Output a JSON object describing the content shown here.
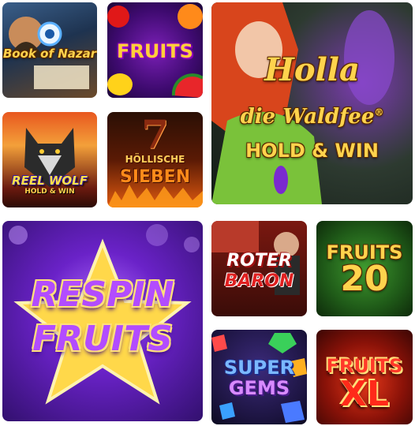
{
  "games": [
    {
      "id": "book-of-nazar",
      "title_line1": "Book",
      "title_line2": "of Nazar"
    },
    {
      "id": "fruits",
      "title": "FRUITS"
    },
    {
      "id": "holla-die-waldfee",
      "title_line1": "Holla",
      "title_line2": "die Waldfee",
      "trademark": "®",
      "subtitle": "HOLD & WIN"
    },
    {
      "id": "reel-wolf",
      "title": "REEL WOLF",
      "subtitle": "HOLD & WIN"
    },
    {
      "id": "hoellische-sieben",
      "number": "7",
      "title_line1": "HÖLLISCHE",
      "title_line2": "SIEBEN"
    },
    {
      "id": "respin-fruits",
      "title_line1": "RESPIN",
      "title_line2": "FRUITS"
    },
    {
      "id": "roter-baron",
      "title_line1": "ROTER",
      "title_line2": "BARON"
    },
    {
      "id": "fruits-20",
      "title_line1": "FRUITS",
      "title_line2": "20"
    },
    {
      "id": "super-gems",
      "title_line1": "SUPER",
      "title_line2": "GEMS"
    },
    {
      "id": "fruits-xl",
      "title_line1": "FRUITS",
      "title_line2": "XL"
    }
  ],
  "colors": {
    "gold": "#ffd34d",
    "purple": "#6a22c8",
    "red": "#c4141a",
    "green": "#3f9a2f"
  }
}
